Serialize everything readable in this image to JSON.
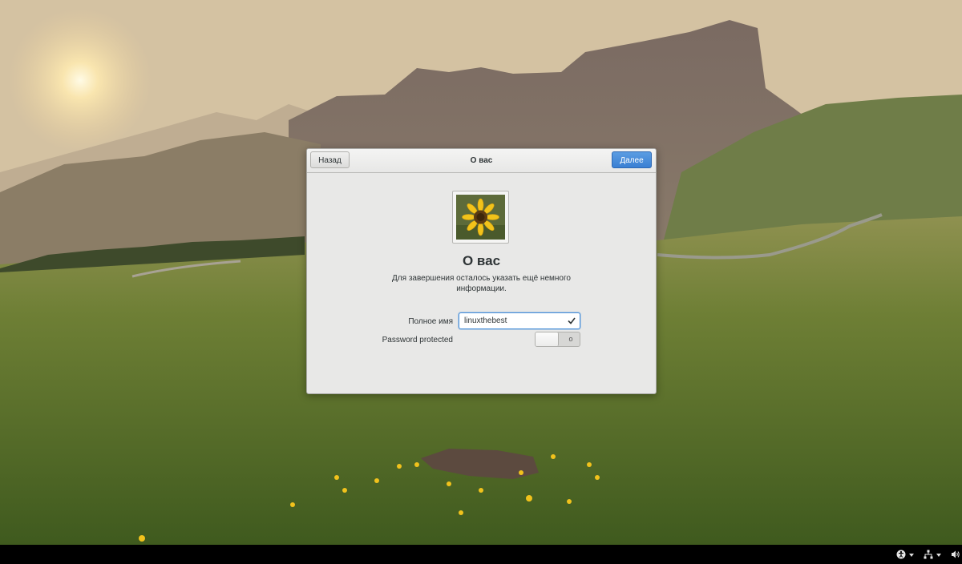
{
  "dialog": {
    "header_title": "О вас",
    "back_label": "Назад",
    "next_label": "Далее",
    "page_title": "О вас",
    "subtitle": "Для завершения осталось указать ещё немного информации.",
    "full_name_label": "Полное имя",
    "full_name_value": "linuxthebest",
    "password_label": "Password protected",
    "password_switch": {
      "state": "off",
      "off_mark": "o"
    },
    "avatar_icon": "sunflower-image"
  },
  "panel": {
    "icons": [
      "accessibility-icon",
      "network-icon",
      "volume-icon"
    ]
  },
  "colors": {
    "suggested_action": "#3a7fd3",
    "focus_border": "#4a90d9",
    "dialog_bg": "#e8e8e7",
    "panel_bg": "#000000"
  }
}
